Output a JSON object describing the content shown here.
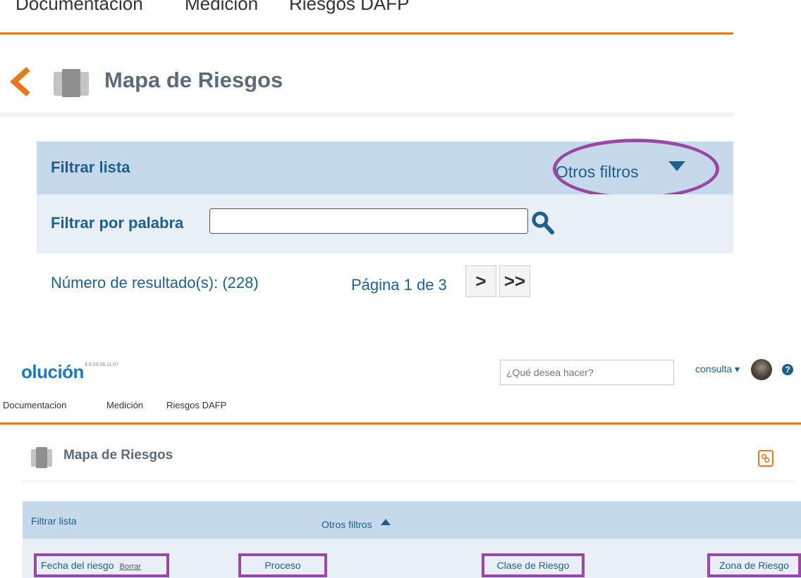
{
  "top": {
    "nav": [
      "Documentacion",
      "Medición",
      "Riesgos DAFP"
    ],
    "title": "Mapa de Riesgos",
    "filter_list_label": "Filtrar lista",
    "other_filters_label": "Otros filtros",
    "filter_by_word_label": "Filtrar por palabra",
    "word_input_value": "",
    "results_text": "Número de resultado(s): (228)",
    "page_text": "Página 1 de 3",
    "next_label": ">",
    "last_label": ">>"
  },
  "header": {
    "brand": "olución",
    "version": "4.8.20.06.11.07",
    "search_placeholder": "¿Qué desea hacer?",
    "user_label": "consulta ▾",
    "help_label": "?"
  },
  "bottom": {
    "nav": [
      "Documentacion",
      "Medición",
      "Riesgos DAFP"
    ],
    "title": "Mapa de Riesgos",
    "filter_list_label": "Filtrar lista",
    "other_filters_label": "Otros filtros",
    "filters": {
      "fecha": "Fecha del riesgo",
      "fecha_clear": "Borrar",
      "proceso": "Proceso",
      "clase": "Clase de Riesgo",
      "zona": "Zona de Riesgo"
    }
  },
  "colors": {
    "accent_orange": "#e8781e",
    "primary_blue": "#1f5f8b",
    "filter_header_bg": "#c6d9ea",
    "filter_row_bg": "#e8eff7",
    "highlight_purple": "#9b47a6"
  }
}
